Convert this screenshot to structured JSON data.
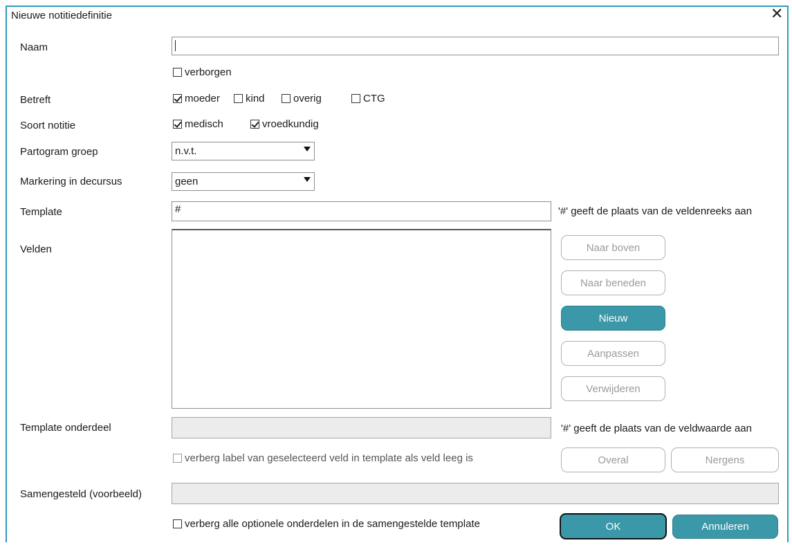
{
  "window": {
    "title": "Nieuwe notitiedefinitie",
    "close_glyph": "✕"
  },
  "naam": {
    "label": "Naam",
    "value": ""
  },
  "verborgen": {
    "label": "verborgen",
    "checked": false
  },
  "betreft": {
    "label": "Betreft",
    "options": [
      {
        "label": "moeder",
        "checked": true
      },
      {
        "label": "kind",
        "checked": false
      },
      {
        "label": "overig",
        "checked": false
      },
      {
        "label": "CTG",
        "checked": false
      }
    ]
  },
  "soort": {
    "label": "Soort notitie",
    "options": [
      {
        "label": "medisch",
        "checked": true
      },
      {
        "label": "vroedkundig",
        "checked": true
      }
    ]
  },
  "partogram": {
    "label": "Partogram groep",
    "value": "n.v.t."
  },
  "markering": {
    "label": "Markering in decursus",
    "value": "geen"
  },
  "template": {
    "label": "Template",
    "value": "#",
    "hint": "'#' geeft de plaats van de veldenreeks aan"
  },
  "velden": {
    "label": "Velden",
    "buttons": {
      "up": "Naar boven",
      "down": "Naar beneden",
      "new": "Nieuw",
      "edit": "Aanpassen",
      "delete": "Verwijderen"
    }
  },
  "template_onderdeel": {
    "label": "Template onderdeel",
    "value": "",
    "hint": "'#' geeft de plaats van de veldwaarde aan"
  },
  "verberg_label": {
    "label": "verberg label van geselecteerd veld in template als veld leeg is",
    "checked": false
  },
  "overal": "Overal",
  "nergens": "Nergens",
  "samengesteld": {
    "label": "Samengesteld (voorbeeld)",
    "value": ""
  },
  "verberg_optioneel": {
    "label": "verberg alle optionele onderdelen in de samengestelde template",
    "checked": false
  },
  "footer": {
    "ok": "OK",
    "cancel": "Annuleren"
  },
  "colors": {
    "accent": "#3a98a8",
    "frame": "#2e9bb8"
  }
}
